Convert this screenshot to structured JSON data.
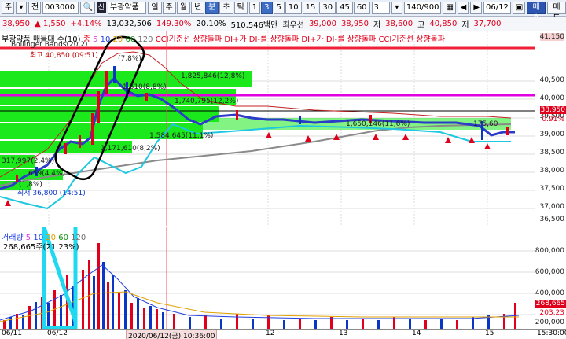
{
  "toolbar": {
    "mode": "주",
    "dropdown": "▾",
    "jeon": "전",
    "code": "003000",
    "sin": "신",
    "name": "부광약품",
    "periods": [
      "일",
      "주",
      "월",
      "년",
      "분",
      "초",
      "틱"
    ],
    "active_period": "분",
    "minutes": [
      "1",
      "3",
      "5",
      "10",
      "15",
      "30",
      "45",
      "60"
    ],
    "active_minute": "3",
    "interval_value": "3",
    "count": "140/900",
    "date": "06/12",
    "buy": "매수",
    "sell": "매도"
  },
  "quote": {
    "price": "38,950",
    "change": "▲ 1,550",
    "change_pct": "+4.14%",
    "volume": "13,032,506",
    "turnover": "149.30%",
    "ratio": "20.10%",
    "amount": "510,546백만",
    "best_ask_label": "최우선",
    "best_ask": "39,000",
    "best_bid": "38,950",
    "low_label": "저",
    "low": "38,600",
    "high_label": "고",
    "high": "40,850",
    "close_label": "저",
    "close": "37,700"
  },
  "price_pane": {
    "title": "부광약품 매물대 수(10)",
    "ma_label": "종",
    "ma_periods": [
      "5",
      "10",
      "20",
      "60",
      "120"
    ],
    "signals": [
      "CCI기준선 상향돌파",
      "DI+가 DI-를 상향돌파",
      "DI+가 DI-를 상향돌파",
      "CCI기준선 상향돌파"
    ],
    "bollinger": "Bollinger Bands(20,2)",
    "high_note": "최고 40,850 (09:51)",
    "low_note": "최저 36,800 (14:51)",
    "band_labels": [
      "1,825,846(12,8%)",
      "1,740,795(12,2%)",
      "1,584,645(11,1%)",
      "1,650,146(11,6%)",
      "1,171,610(8,2%)",
      "317,997(2,4%)",
      "659(4,4%)",
      "(1,8%)",
      "(7,8%)",
      "1,610(8,8%)",
      "175,60"
    ],
    "axis": [
      "41,150",
      "40,500",
      "40,000",
      "39,500",
      "39,000",
      "38,950",
      "38,500",
      "38,000",
      "37,500",
      "37,000",
      "36,500"
    ],
    "current_pct": "0.91%"
  },
  "vol_pane": {
    "title": "거래량",
    "ma_periods": [
      "5",
      "10",
      "20",
      "60",
      "120"
    ],
    "value": "268,665주(21.23%)",
    "axis": [
      "800,000",
      "600,000",
      "400,000",
      "200,000"
    ],
    "current": "268,665",
    "current2": "203,23"
  },
  "time_axis": {
    "labels": [
      "06/11",
      "06/12",
      "2020/06/12(금) 10:36:00",
      "12",
      "13",
      "14",
      "15",
      "15:30:00"
    ]
  },
  "colors": {
    "up": "#e0001b",
    "down": "#0a36c8",
    "band": "#00e000",
    "magenta": "#e000e0",
    "cyan": "#20d8f0"
  }
}
